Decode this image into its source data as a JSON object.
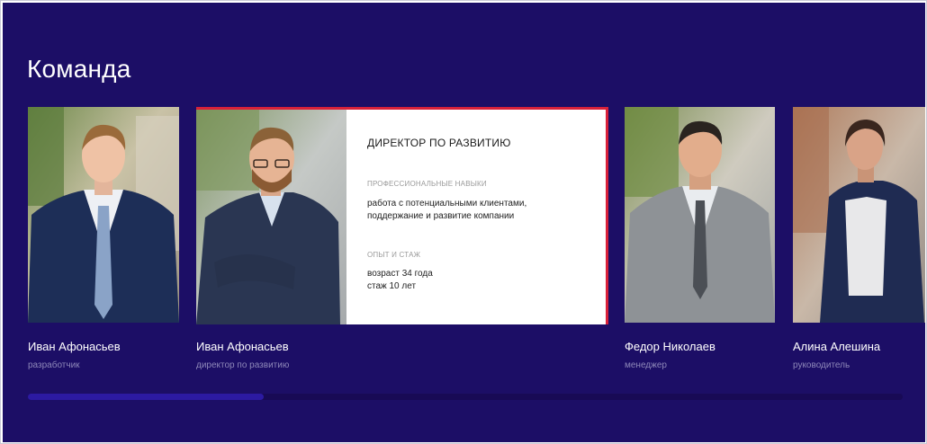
{
  "section": {
    "title": "Команда"
  },
  "members": [
    {
      "name": "Иван Афонасьев",
      "role": "разработчик"
    },
    {
      "name": "Иван Афонасьев",
      "role": "директор по развитию"
    },
    {
      "name": "Федор Николаев",
      "role": "менеджер"
    },
    {
      "name": "Алина Алешина",
      "role": "руководитель"
    }
  ],
  "expanded": {
    "title": "ДИРЕКТОР ПО РАЗВИТИЮ",
    "skills_label": "ПРОФЕССИОНАЛЬНЫЕ НАВЫКИ",
    "skills_line1": "работа с потенциальными клиентами,",
    "skills_line2": "поддержание и развитие компании",
    "experience_label": "ОПЫТ И СТАЖ",
    "experience_line1": "возраст 34 года",
    "experience_line2": "стаж 10 лет"
  },
  "scroll": {
    "position_fraction": 0.27
  },
  "colors": {
    "background": "#1c0e66",
    "accent": "#d8213a",
    "thumb": "#2c1aa2"
  }
}
